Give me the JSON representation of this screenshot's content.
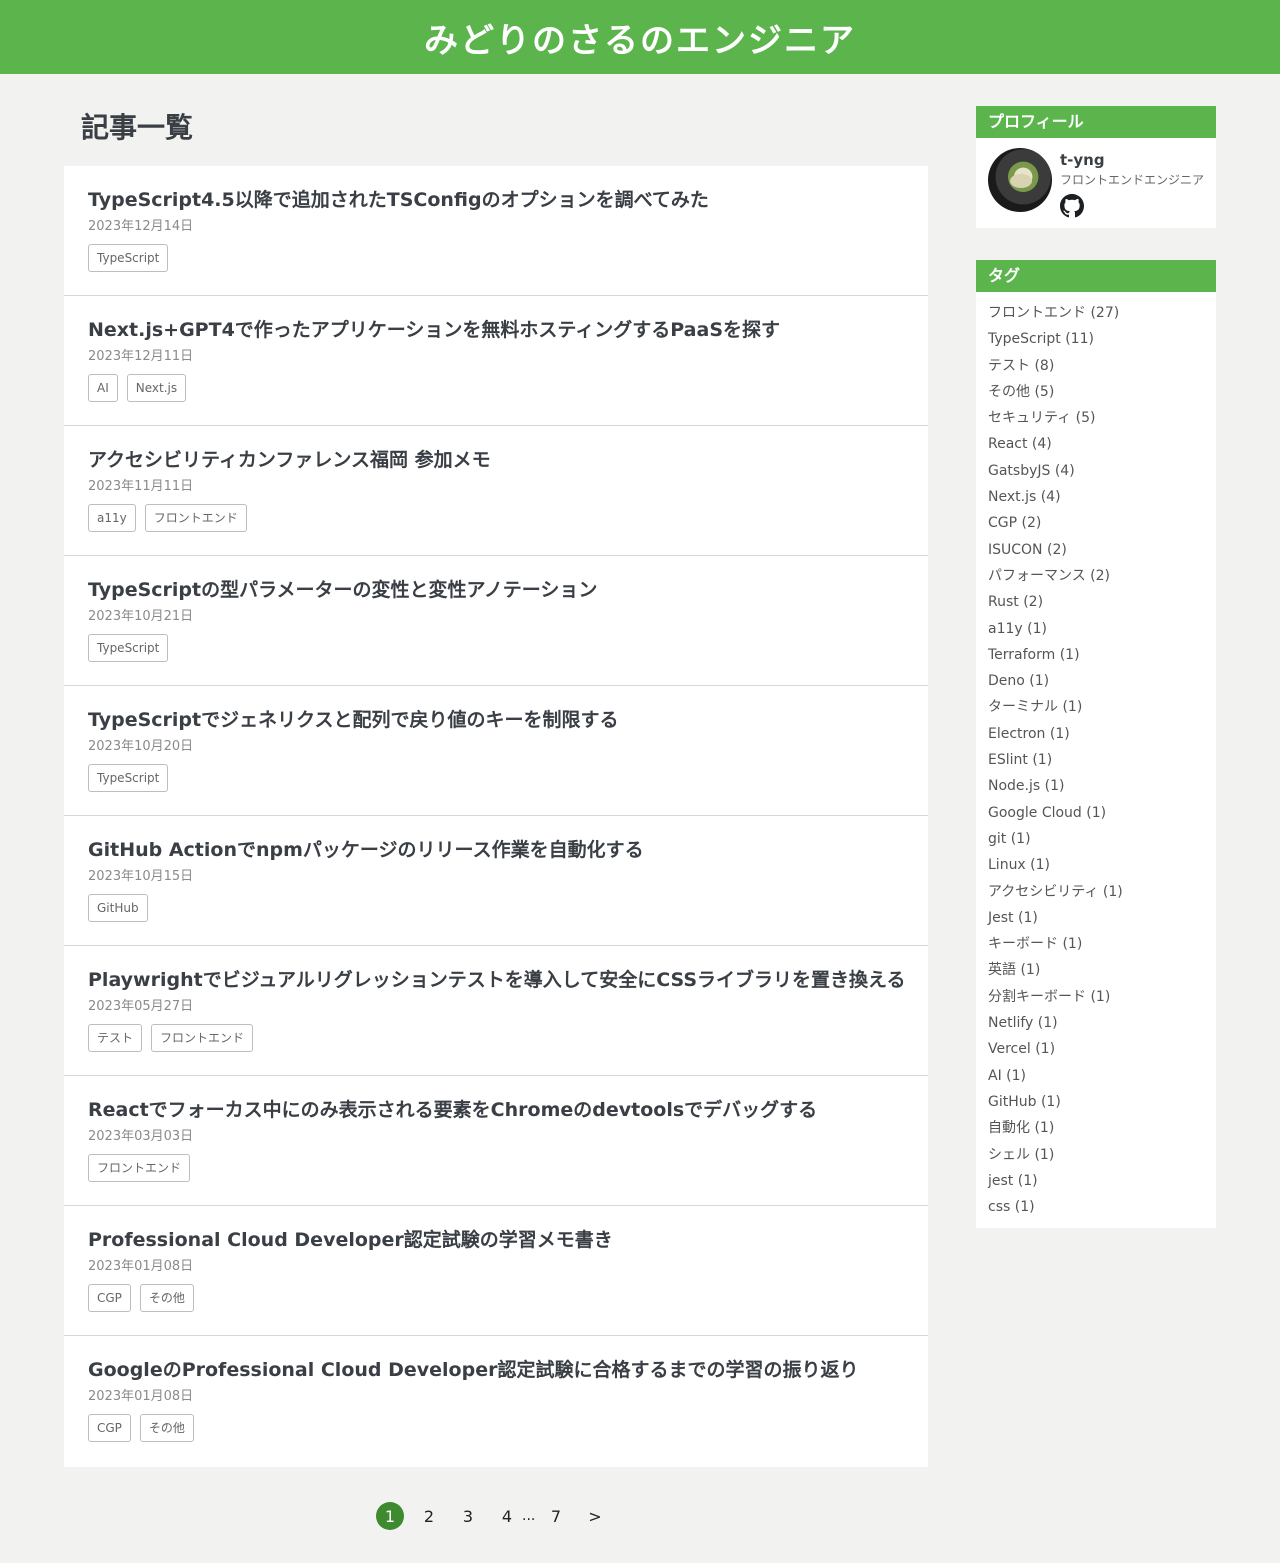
{
  "site": {
    "title": "みどりのさるのエンジニア"
  },
  "main": {
    "heading": "記事一覧",
    "articles": [
      {
        "title": "TypeScript4.5以降で追加されたTSConfigのオプションを調べてみた",
        "date": "2023年12月14日",
        "tags": [
          "TypeScript"
        ]
      },
      {
        "title": "Next.js+GPT4で作ったアプリケーションを無料ホスティングするPaaSを探す",
        "date": "2023年12月11日",
        "tags": [
          "AI",
          "Next.js"
        ]
      },
      {
        "title": "アクセシビリティカンファレンス福岡 参加メモ",
        "date": "2023年11月11日",
        "tags": [
          "a11y",
          "フロントエンド"
        ]
      },
      {
        "title": "TypeScriptの型パラメーターの変性と変性アノテーション",
        "date": "2023年10月21日",
        "tags": [
          "TypeScript"
        ]
      },
      {
        "title": "TypeScriptでジェネリクスと配列で戻り値のキーを制限する",
        "date": "2023年10月20日",
        "tags": [
          "TypeScript"
        ]
      },
      {
        "title": "GitHub Actionでnpmパッケージのリリース作業を自動化する",
        "date": "2023年10月15日",
        "tags": [
          "GitHub"
        ]
      },
      {
        "title": "Playwrightでビジュアルリグレッションテストを導入して安全にCSSライブラリを置き換える",
        "date": "2023年05月27日",
        "tags": [
          "テスト",
          "フロントエンド"
        ]
      },
      {
        "title": "Reactでフォーカス中にのみ表示される要素をChromeのdevtoolsでデバッグする",
        "date": "2023年03月03日",
        "tags": [
          "フロントエンド"
        ]
      },
      {
        "title": "Professional Cloud Developer認定試験の学習メモ書き",
        "date": "2023年01月08日",
        "tags": [
          "CGP",
          "その他"
        ]
      },
      {
        "title": "GoogleのProfessional Cloud Developer認定試験に合格するまでの学習の振り返り",
        "date": "2023年01月08日",
        "tags": [
          "CGP",
          "その他"
        ]
      }
    ]
  },
  "pagination": {
    "pages": [
      "1",
      "2",
      "3",
      "4"
    ],
    "ellipsis": "...",
    "last": "7",
    "next": ">",
    "current": "1",
    "current_color": "#3d8a2f"
  },
  "sidebar": {
    "profile": {
      "header": "プロフィール",
      "name": "t-yng",
      "role": "フロントエンドエンジニア",
      "github_icon": "github-icon"
    },
    "tags": {
      "header": "タグ",
      "items": [
        "フロントエンド (27)",
        "TypeScript (11)",
        "テスト (8)",
        "その他 (5)",
        "セキュリティ (5)",
        "React (4)",
        "GatsbyJS (4)",
        "Next.js (4)",
        "CGP (2)",
        "ISUCON (2)",
        "パフォーマンス (2)",
        "Rust (2)",
        "a11y (1)",
        "Terraform (1)",
        "Deno (1)",
        "ターミナル (1)",
        "Electron (1)",
        "ESlint (1)",
        "Node.js (1)",
        "Google Cloud (1)",
        "git (1)",
        "Linux (1)",
        "アクセシビリティ (1)",
        "Jest (1)",
        "キーボード (1)",
        "英語 (1)",
        "分割キーボード (1)",
        "Netlify (1)",
        "Vercel (1)",
        "AI (1)",
        "GitHub (1)",
        "自動化 (1)",
        "シェル (1)",
        "jest (1)",
        "css (1)"
      ]
    }
  },
  "colors": {
    "brand": "#5cb54c",
    "background": "#f2f2f1",
    "text": "#3a3f45"
  }
}
